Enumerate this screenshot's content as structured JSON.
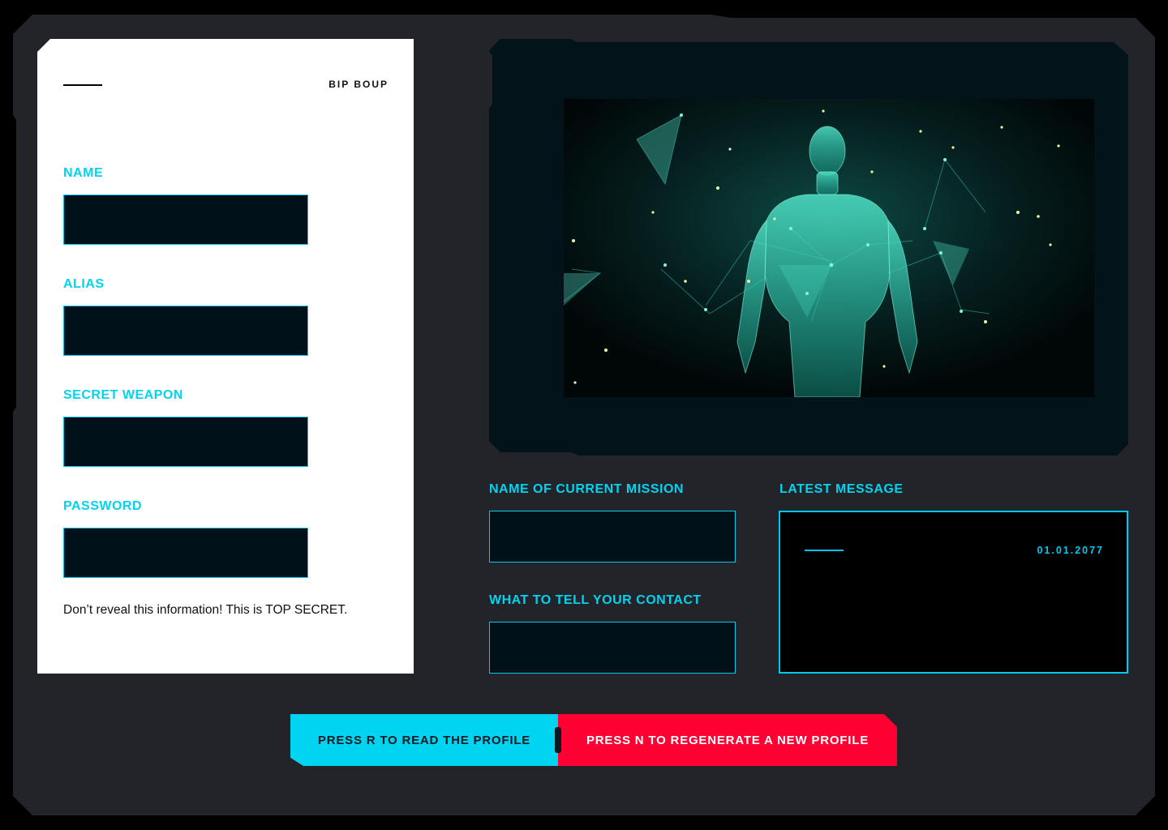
{
  "card": {
    "tag": "BIP BOUP",
    "fields": [
      {
        "label": "NAME",
        "value": ""
      },
      {
        "label": "ALIAS",
        "value": ""
      },
      {
        "label": "SECRET WEAPON",
        "value": ""
      },
      {
        "label": "PASSWORD",
        "value": ""
      }
    ],
    "note": "Don’t reveal this information! This is TOP SECRET."
  },
  "mission": {
    "name_label": "NAME OF CURRENT MISSION",
    "contact_label": "WHAT TO TELL YOUR CONTACT"
  },
  "message": {
    "label": "LATEST MESSAGE",
    "date": "01.01.2077"
  },
  "buttons": {
    "read": "PRESS R TO READ THE PROFILE",
    "regenerate": "PRESS N TO REGENERATE A NEW PROFILE"
  },
  "colors": {
    "accent": "#00d4f0",
    "danger": "#ff0033",
    "frame": "#23232a"
  }
}
